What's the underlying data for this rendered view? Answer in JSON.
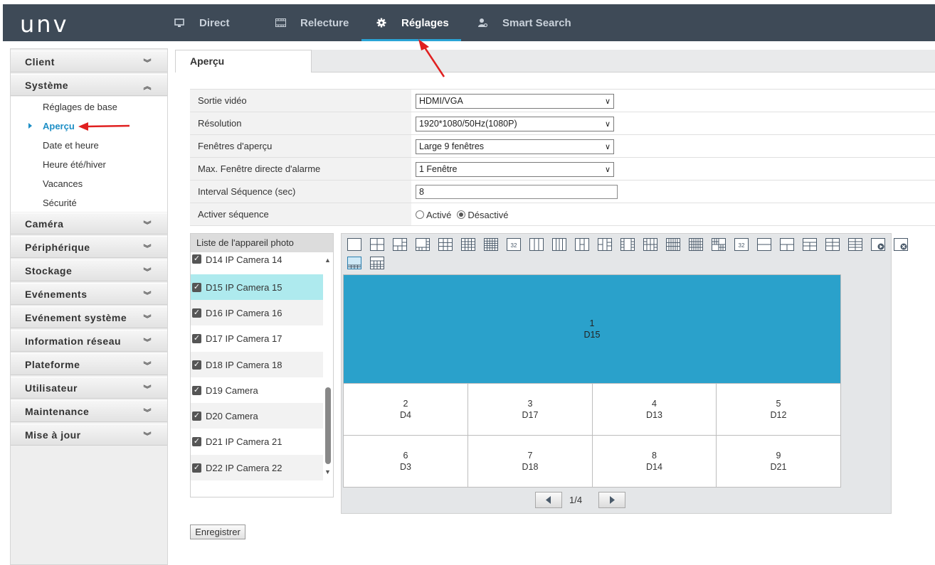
{
  "brand": {
    "logo": "UNV",
    "accent": "#2aa4d6",
    "topbar_bg": "#3e4a57"
  },
  "nav": {
    "items": [
      {
        "label": "Direct",
        "icon": "monitor-icon",
        "active": false
      },
      {
        "label": "Relecture",
        "icon": "film-icon",
        "active": false
      },
      {
        "label": "Réglages",
        "icon": "gear-icon",
        "active": true
      },
      {
        "label": "Smart Search",
        "icon": "person-search-icon",
        "active": false
      }
    ]
  },
  "sidebar": {
    "sections": [
      {
        "label": "Client",
        "expanded": false
      },
      {
        "label": "Système",
        "expanded": true
      },
      {
        "label": "Caméra",
        "expanded": false
      },
      {
        "label": "Périphérique",
        "expanded": false
      },
      {
        "label": "Stockage",
        "expanded": false
      },
      {
        "label": "Evénements",
        "expanded": false
      },
      {
        "label": "Evénement système",
        "expanded": false
      },
      {
        "label": "Information réseau",
        "expanded": false
      },
      {
        "label": "Plateforme",
        "expanded": false
      },
      {
        "label": "Utilisateur",
        "expanded": false
      },
      {
        "label": "Maintenance",
        "expanded": false
      },
      {
        "label": "Mise à jour",
        "expanded": false
      }
    ],
    "system_items": [
      "Réglages de base",
      "Aperçu",
      "Date et heure",
      "Heure été/hiver",
      "Vacances",
      "Sécurité"
    ],
    "active_item": "Aperçu"
  },
  "tab": {
    "label": "Aperçu"
  },
  "form": {
    "video_output": {
      "label": "Sortie vidéo",
      "value": "HDMI/VGA"
    },
    "resolution": {
      "label": "Résolution",
      "value": "1920*1080/50Hz(1080P)"
    },
    "preview_windows": {
      "label": "Fenêtres d'aperçu",
      "value": "Large 9 fenêtres"
    },
    "max_alarm_window": {
      "label": "Max. Fenêtre directe d'alarme",
      "value": "1 Fenêtre"
    },
    "sequence_interval": {
      "label": "Interval Séquence (sec)",
      "value": "8"
    },
    "sequence_enable": {
      "label": "Activer séquence",
      "option_on": "Activé",
      "option_off": "Désactivé",
      "selected": "Désactivé"
    }
  },
  "camera_list": {
    "title": "Liste de l'appareil photo",
    "items": [
      {
        "label": "D14 IP Camera 14",
        "checked": true
      },
      {
        "label": "D15 IP Camera 15",
        "checked": true,
        "selected": true
      },
      {
        "label": "D16 IP Camera 16",
        "checked": true
      },
      {
        "label": "D17 IP Camera 17",
        "checked": true
      },
      {
        "label": "D18 IP Camera 18",
        "checked": true
      },
      {
        "label": "D19 Camera",
        "checked": true
      },
      {
        "label": "D20 Camera",
        "checked": true
      },
      {
        "label": "D21 IP Camera 21",
        "checked": true
      },
      {
        "label": "D22 IP Camera 22",
        "checked": true
      }
    ]
  },
  "layout_icons": {
    "row1": [
      "layout-1-icon",
      "layout-4-icon",
      "layout-6-icon",
      "layout-8-icon",
      "layout-9-icon",
      "layout-16-icon",
      "layout-25-icon",
      "layout-32-icon",
      "layout-3col-icon",
      "layout-4col-icon",
      "layout-split-v-icon",
      "layout-split-grid-icon",
      "layout-center-icon",
      "layout-mixed-icon",
      "layout-many-icon",
      "layout-dense-icon",
      "layout-32b-icon",
      "layout-2row-icon",
      "layout-2rowb-icon",
      "layout-3row-icon",
      "layout-3rowb-icon",
      "layout-4row-icon",
      "layout-custom-add-icon",
      "layout-custom-del-icon"
    ],
    "row2": [
      "layout-large9-icon",
      "layout-grid-icon"
    ],
    "page_label": "32"
  },
  "grid_cells": [
    {
      "num": "1",
      "cam": "D15"
    },
    {
      "num": "2",
      "cam": "D4"
    },
    {
      "num": "3",
      "cam": "D17"
    },
    {
      "num": "4",
      "cam": "D13"
    },
    {
      "num": "5",
      "cam": "D12"
    },
    {
      "num": "6",
      "cam": "D3"
    },
    {
      "num": "7",
      "cam": "D18"
    },
    {
      "num": "8",
      "cam": "D14"
    },
    {
      "num": "9",
      "cam": "D21"
    }
  ],
  "pager": {
    "text": "1/4"
  },
  "save_label": "Enregistrer",
  "colors": {
    "highlight_cell": "#2aa1cb",
    "selected_row": "#aeeaee",
    "annotation_arrow": "#e02020"
  }
}
